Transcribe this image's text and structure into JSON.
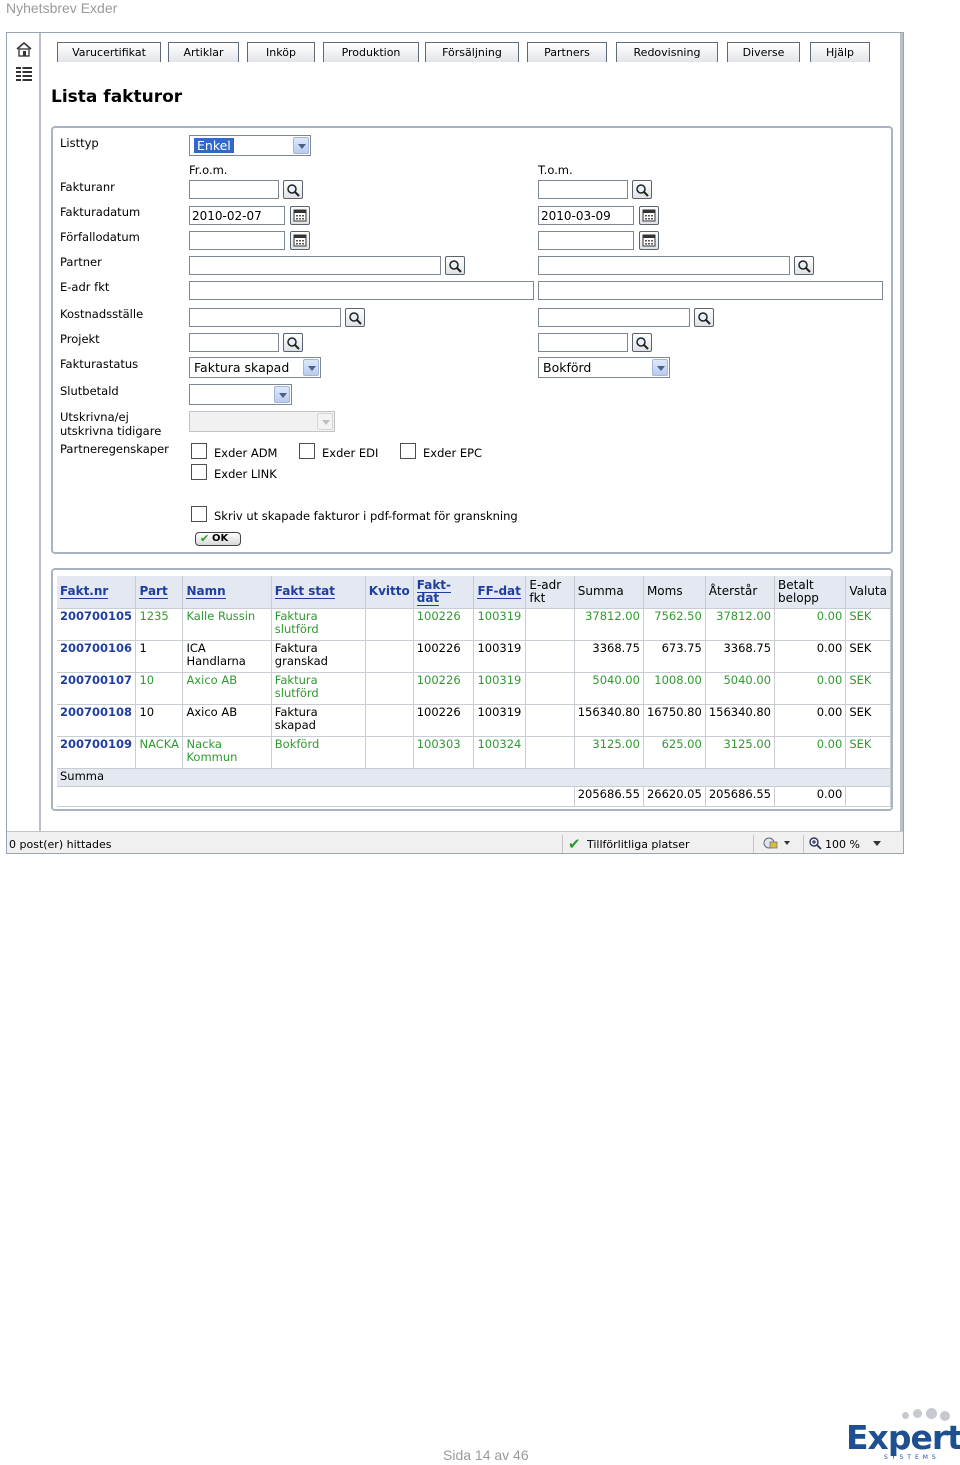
{
  "document": {
    "header": "Nyhetsbrev Exder",
    "page_number": "Sida 14 av 46",
    "logo_text": "Expert",
    "logo_sub": "SYSTEMS"
  },
  "nav": {
    "tabs": [
      "Varucertifikat",
      "Artiklar",
      "Inköp",
      "Produktion",
      "Försäljning",
      "Partners",
      "Redovisning",
      "Diverse",
      "Hjälp"
    ]
  },
  "page": {
    "title": "Lista fakturor"
  },
  "form": {
    "listtyp": {
      "label": "Listtyp",
      "value": "Enkel"
    },
    "from_header": "Fr.o.m.",
    "tom_header": "T.o.m.",
    "fakturanr": {
      "label": "Fakturanr",
      "from": "",
      "to": ""
    },
    "fakturadatum": {
      "label": "Fakturadatum",
      "from": "2010-02-07",
      "to": "2010-03-09"
    },
    "forfallodatum": {
      "label": "Förfallodatum",
      "from": "",
      "to": ""
    },
    "partner": {
      "label": "Partner",
      "from": "",
      "to": ""
    },
    "eadr": {
      "label": "E-adr fkt",
      "from": "",
      "to": ""
    },
    "kostnadsstalle": {
      "label": "Kostnadsställe",
      "from": "",
      "to": ""
    },
    "projekt": {
      "label": "Projekt",
      "from": "",
      "to": ""
    },
    "fakturastatus": {
      "label": "Fakturastatus",
      "from": "Faktura skapad",
      "to": "Bokförd"
    },
    "slutbetald": {
      "label": "Slutbetald",
      "value": ""
    },
    "utskrivna": {
      "label_line1": "Utskrivna/ej",
      "label_line2": "utskrivna tidigare",
      "value": ""
    },
    "partneregenskaper": {
      "label": "Partneregenskaper",
      "options": [
        "Exder ADM",
        "Exder EDI",
        "Exder EPC",
        "Exder LINK"
      ]
    },
    "pdf_option": "Skriv ut skapade fakturor i pdf-format för granskning",
    "ok_label": "OK"
  },
  "table": {
    "headers": [
      "Fakt.nr",
      "Part",
      "Namn",
      "Fakt stat",
      "Kvitto",
      "Fakt-dat",
      "FF-dat",
      "E-adr fkt",
      "Summa",
      "Moms",
      "Återstår",
      "Betalt belopp",
      "Valuta"
    ],
    "rows": [
      [
        "200700105",
        "1235",
        "Kalle Russin",
        "Faktura slutförd",
        "",
        "100226",
        "100319",
        "",
        "37812.00",
        "7562.50",
        "37812.00",
        "0.00",
        "SEK"
      ],
      [
        "200700106",
        "1",
        "ICA Handlarna",
        "Faktura granskad",
        "",
        "100226",
        "100319",
        "",
        "3368.75",
        "673.75",
        "3368.75",
        "0.00",
        "SEK"
      ],
      [
        "200700107",
        "10",
        "Axico AB",
        "Faktura slutförd",
        "",
        "100226",
        "100319",
        "",
        "5040.00",
        "1008.00",
        "5040.00",
        "0.00",
        "SEK"
      ],
      [
        "200700108",
        "10",
        "Axico AB",
        "Faktura skapad",
        "",
        "100226",
        "100319",
        "",
        "156340.80",
        "16750.80",
        "156340.80",
        "0.00",
        "SEK"
      ],
      [
        "200700109",
        "NACKA",
        "Nacka Kommun",
        "Bokförd",
        "",
        "100303",
        "100324",
        "",
        "3125.00",
        "625.00",
        "3125.00",
        "0.00",
        "SEK"
      ]
    ],
    "summa_label": "Summa",
    "totals": {
      "summa": "205686.55",
      "moms": "26620.05",
      "aterstar": "205686.55",
      "betalt": "0.00"
    }
  },
  "statusbar": {
    "left": "0 post(er) hittades",
    "zone": "Tillförlitliga platser",
    "zoom": "100 %"
  }
}
